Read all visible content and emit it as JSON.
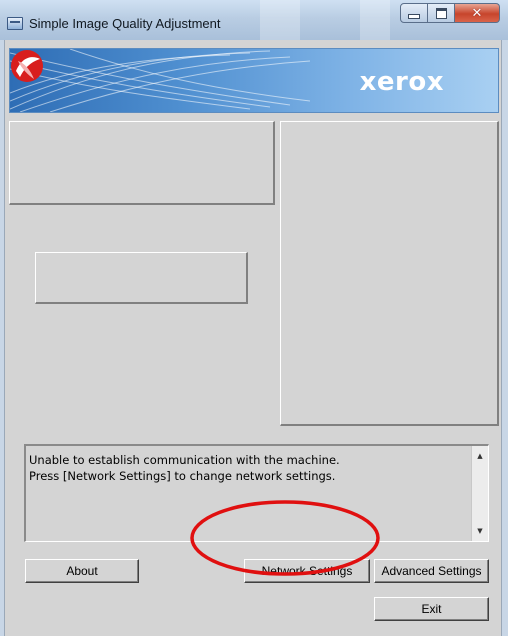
{
  "window": {
    "title": "Simple Image Quality Adjustment"
  },
  "banner": {
    "logo_text": "xerox",
    "colors": {
      "banner_start": "#2e6db5",
      "banner_end": "#a9d0f2",
      "logo_red": "#d81e1e"
    }
  },
  "message": {
    "lines": [
      "Unable to establish communication with the machine.",
      "Press [Network Settings] to change network settings."
    ]
  },
  "buttons": {
    "about": "About",
    "network_settings": "Network Settings",
    "advanced_settings": "Advanced Settings",
    "exit": "Exit"
  },
  "annotation": {
    "color": "#e01010",
    "target": "network-settings-button"
  }
}
